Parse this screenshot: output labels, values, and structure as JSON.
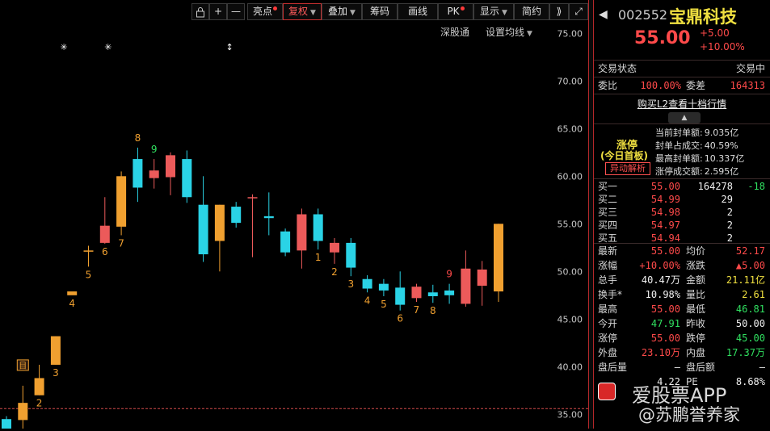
{
  "toolbar": {
    "items": [
      {
        "label": "亮点",
        "dot": true,
        "caret": false
      },
      {
        "label": "复权",
        "dot": false,
        "caret": true,
        "active": true
      },
      {
        "label": "叠加",
        "dot": false,
        "caret": true
      },
      {
        "label": "筹码",
        "dot": false,
        "caret": false
      },
      {
        "label": "画线",
        "dot": false,
        "caret": false
      },
      {
        "label": "PK",
        "dot": true,
        "caret": false
      },
      {
        "label": "显示",
        "dot": false,
        "caret": true
      },
      {
        "label": "简约",
        "dot": false,
        "caret": false
      }
    ],
    "plus": "+",
    "minus": "—",
    "expand": "⟫",
    "fullscreen": "⤢",
    "subtoolbar": {
      "left": "深股通",
      "right": "设置均线"
    }
  },
  "chart_data": {
    "type": "candlestick",
    "y_ticks": [
      "75.00",
      "70.00",
      "65.00",
      "60.00",
      "55.00",
      "50.00",
      "45.00",
      "40.00",
      "35.00"
    ],
    "ylim": [
      33.5,
      78.5
    ],
    "ref_price": 35.6,
    "candles": [
      {
        "o": 32.5,
        "h": 34.8,
        "l": 32.0,
        "c": 34.5,
        "color": "cyan"
      },
      {
        "o": 34.4,
        "h": 38.0,
        "l": 33.2,
        "c": 36.2,
        "color": "orange",
        "label": "1"
      },
      {
        "o": 37.0,
        "h": 40.2,
        "l": 37.0,
        "c": 38.8,
        "color": "orange",
        "label": "2"
      },
      {
        "o": 40.2,
        "h": 43.2,
        "l": 40.2,
        "c": 43.2,
        "color": "orange",
        "label": "3"
      },
      {
        "o": 47.5,
        "h": 47.5,
        "l": 47.5,
        "c": 47.9,
        "color": "orange",
        "label": "4"
      },
      {
        "o": 52.2,
        "h": 52.7,
        "l": 50.5,
        "c": 52.2,
        "color": "orange",
        "label": "5"
      },
      {
        "o": 53.0,
        "h": 57.8,
        "l": 52.9,
        "c": 54.8,
        "color": "red",
        "label": "6"
      },
      {
        "o": 54.7,
        "h": 60.5,
        "l": 53.8,
        "c": 60.0,
        "color": "orange",
        "label": "7"
      },
      {
        "o": 61.8,
        "h": 63.0,
        "l": 57.3,
        "c": 58.8,
        "color": "cyan",
        "label": "8"
      },
      {
        "o": 60.6,
        "h": 61.8,
        "l": 58.7,
        "c": 59.8,
        "color": "red",
        "label": "9"
      },
      {
        "o": 62.2,
        "h": 62.5,
        "l": 58.0,
        "c": 59.9,
        "color": "red"
      },
      {
        "o": 61.8,
        "h": 62.7,
        "l": 57.2,
        "c": 57.8,
        "color": "cyan"
      },
      {
        "o": 57.0,
        "h": 60.0,
        "l": 51.0,
        "c": 51.8,
        "color": "cyan"
      },
      {
        "o": 57.0,
        "h": 57.0,
        "l": 50.0,
        "c": 53.2,
        "color": "orange"
      },
      {
        "o": 56.8,
        "h": 57.3,
        "l": 54.6,
        "c": 55.1,
        "color": "cyan"
      },
      {
        "o": 57.8,
        "h": 58.1,
        "l": 51.5,
        "c": 57.8,
        "color": "red"
      },
      {
        "o": 55.8,
        "h": 58.3,
        "l": 53.8,
        "c": 55.6,
        "color": "cyan"
      },
      {
        "o": 54.2,
        "h": 54.5,
        "l": 51.6,
        "c": 52.0,
        "color": "cyan"
      },
      {
        "o": 52.2,
        "h": 56.6,
        "l": 50.3,
        "c": 56.0,
        "color": "red"
      },
      {
        "o": 56.0,
        "h": 56.6,
        "l": 52.3,
        "c": 53.2,
        "color": "cyan",
        "label": "1"
      },
      {
        "o": 52.0,
        "h": 53.5,
        "l": 50.8,
        "c": 53.0,
        "color": "red",
        "label": "2"
      },
      {
        "o": 53.0,
        "h": 53.5,
        "l": 49.5,
        "c": 50.4,
        "color": "cyan",
        "label": "3"
      },
      {
        "o": 49.2,
        "h": 49.6,
        "l": 47.8,
        "c": 48.2,
        "color": "cyan",
        "label": "4"
      },
      {
        "o": 48.7,
        "h": 49.2,
        "l": 47.4,
        "c": 48.0,
        "color": "cyan",
        "label": "5"
      },
      {
        "o": 48.3,
        "h": 50.0,
        "l": 45.9,
        "c": 46.5,
        "color": "cyan",
        "label": "6"
      },
      {
        "o": 47.2,
        "h": 48.7,
        "l": 46.8,
        "c": 48.4,
        "color": "red",
        "label": "7"
      },
      {
        "o": 47.8,
        "h": 48.6,
        "l": 46.7,
        "c": 47.4,
        "color": "cyan",
        "label": "8"
      },
      {
        "o": 47.5,
        "h": 48.7,
        "l": 46.6,
        "c": 48.0,
        "color": "cyan",
        "label": "9"
      },
      {
        "o": 46.6,
        "h": 52.2,
        "l": 46.3,
        "c": 50.3,
        "color": "red"
      },
      {
        "o": 48.5,
        "h": 51.1,
        "l": 46.4,
        "c": 50.2,
        "color": "red"
      },
      {
        "o": 47.9,
        "h": 55.0,
        "l": 46.8,
        "c": 55.0,
        "color": "orange"
      }
    ],
    "markers": [
      {
        "glyph": "✳",
        "candle": 3.5
      },
      {
        "glyph": "✳",
        "candle": 6.2
      },
      {
        "glyph": "↕",
        "candle": 13.6
      }
    ],
    "badge": {
      "text": "目",
      "candle": 1
    }
  },
  "stock": {
    "code": "002552",
    "name": "宝鼎科技",
    "price": "55.00",
    "change": "+5.00",
    "change_pct": "+10.00%"
  },
  "status": {
    "label": "交易状态",
    "value": "交易中"
  },
  "ratio": {
    "label1": "委比",
    "value1": "100.00%",
    "label2": "委差",
    "value2": "164313"
  },
  "l2_link": "购买L2查看十档行情",
  "limit_up": {
    "tag": "涨停",
    "sub": "(今日首板)",
    "button": "异动解析",
    "lines": [
      {
        "label": "当前封单额:",
        "value": "9.035亿"
      },
      {
        "label": "封单占成交:",
        "value": "40.59%"
      },
      {
        "label": "最高封单额:",
        "value": "10.337亿"
      },
      {
        "label": "涨停成交额:",
        "value": "2.595亿"
      }
    ]
  },
  "orderbook": [
    {
      "label": "买一",
      "price": "55.00",
      "vol": "164278",
      "delta": "-18"
    },
    {
      "label": "买二",
      "price": "54.99",
      "vol": "29",
      "delta": ""
    },
    {
      "label": "买三",
      "price": "54.98",
      "vol": "2",
      "delta": ""
    },
    {
      "label": "买四",
      "price": "54.97",
      "vol": "2",
      "delta": ""
    },
    {
      "label": "买五",
      "price": "54.94",
      "vol": "2",
      "delta": ""
    }
  ],
  "stats": [
    {
      "l1": "最新",
      "v1": "55.00",
      "c1": "red",
      "l2": "均价",
      "v2": "52.17",
      "c2": "red"
    },
    {
      "l1": "涨幅",
      "v1": "+10.00%",
      "c1": "red",
      "l2": "涨跌",
      "v2": "▲5.00",
      "c2": "red"
    },
    {
      "l1": "总手",
      "v1": "40.47万",
      "c1": "white",
      "l2": "金额",
      "v2": "21.11亿",
      "c2": "yel"
    },
    {
      "l1": "换手*",
      "v1": "10.98%",
      "c1": "white",
      "l2": "量比",
      "v2": "2.61",
      "c2": "yel"
    },
    {
      "l1": "最高",
      "v1": "55.00",
      "c1": "red",
      "l2": "最低",
      "v2": "46.81",
      "c2": "green"
    },
    {
      "l1": "今开",
      "v1": "47.91",
      "c1": "green",
      "l2": "昨收",
      "v2": "50.00",
      "c2": "white"
    },
    {
      "l1": "涨停",
      "v1": "55.00",
      "c1": "red",
      "l2": "跌停",
      "v2": "45.00",
      "c2": "green"
    },
    {
      "l1": "外盘",
      "v1": "23.10万",
      "c1": "red",
      "l2": "内盘",
      "v2": "17.37万",
      "c2": "green"
    },
    {
      "l1": "盘后量",
      "v1": "—",
      "c1": "white",
      "l2": "盘后额",
      "v2": "—",
      "c2": "white"
    },
    {
      "l1": "",
      "v1": "4.22",
      "c1": "white",
      "l2": "PE",
      "v2": "8.68%",
      "c2": "white"
    }
  ],
  "watermark": {
    "app": "爱股票APP",
    "handle": "@苏鹏誉养家"
  }
}
